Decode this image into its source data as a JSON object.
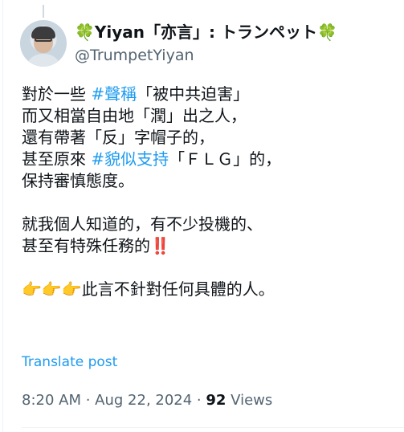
{
  "author": {
    "display_name": "🍀Yiyan「亦言」: トランペット🍀",
    "handle": "@TrumpetYiyan"
  },
  "post": {
    "lines": [
      {
        "a": "對於一些 ",
        "tag": "#聲稱",
        "b": "「被中共迫害」"
      },
      {
        "a": "而又相當自由地「潤」出之人，"
      },
      {
        "a": "還有帶著「反」字帽子的，"
      },
      {
        "a": "甚至原來 ",
        "tag": "#貌似支持",
        "b": "「ＦＬＧ」的，"
      },
      {
        "a": "保持審慎態度。"
      },
      {
        "a": ""
      },
      {
        "a": "就我個人知道的，有不少投機的、"
      },
      {
        "a": "甚至有特殊任務的‼️"
      },
      {
        "a": ""
      },
      {
        "a": "👉👉👉此言不針對任何具體的人。"
      }
    ]
  },
  "translate_label": "Translate post",
  "meta": {
    "time": "8:20 AM",
    "separator": " · ",
    "date": "Aug 22, 2024",
    "views_count": "92",
    "views_label": "Views"
  }
}
